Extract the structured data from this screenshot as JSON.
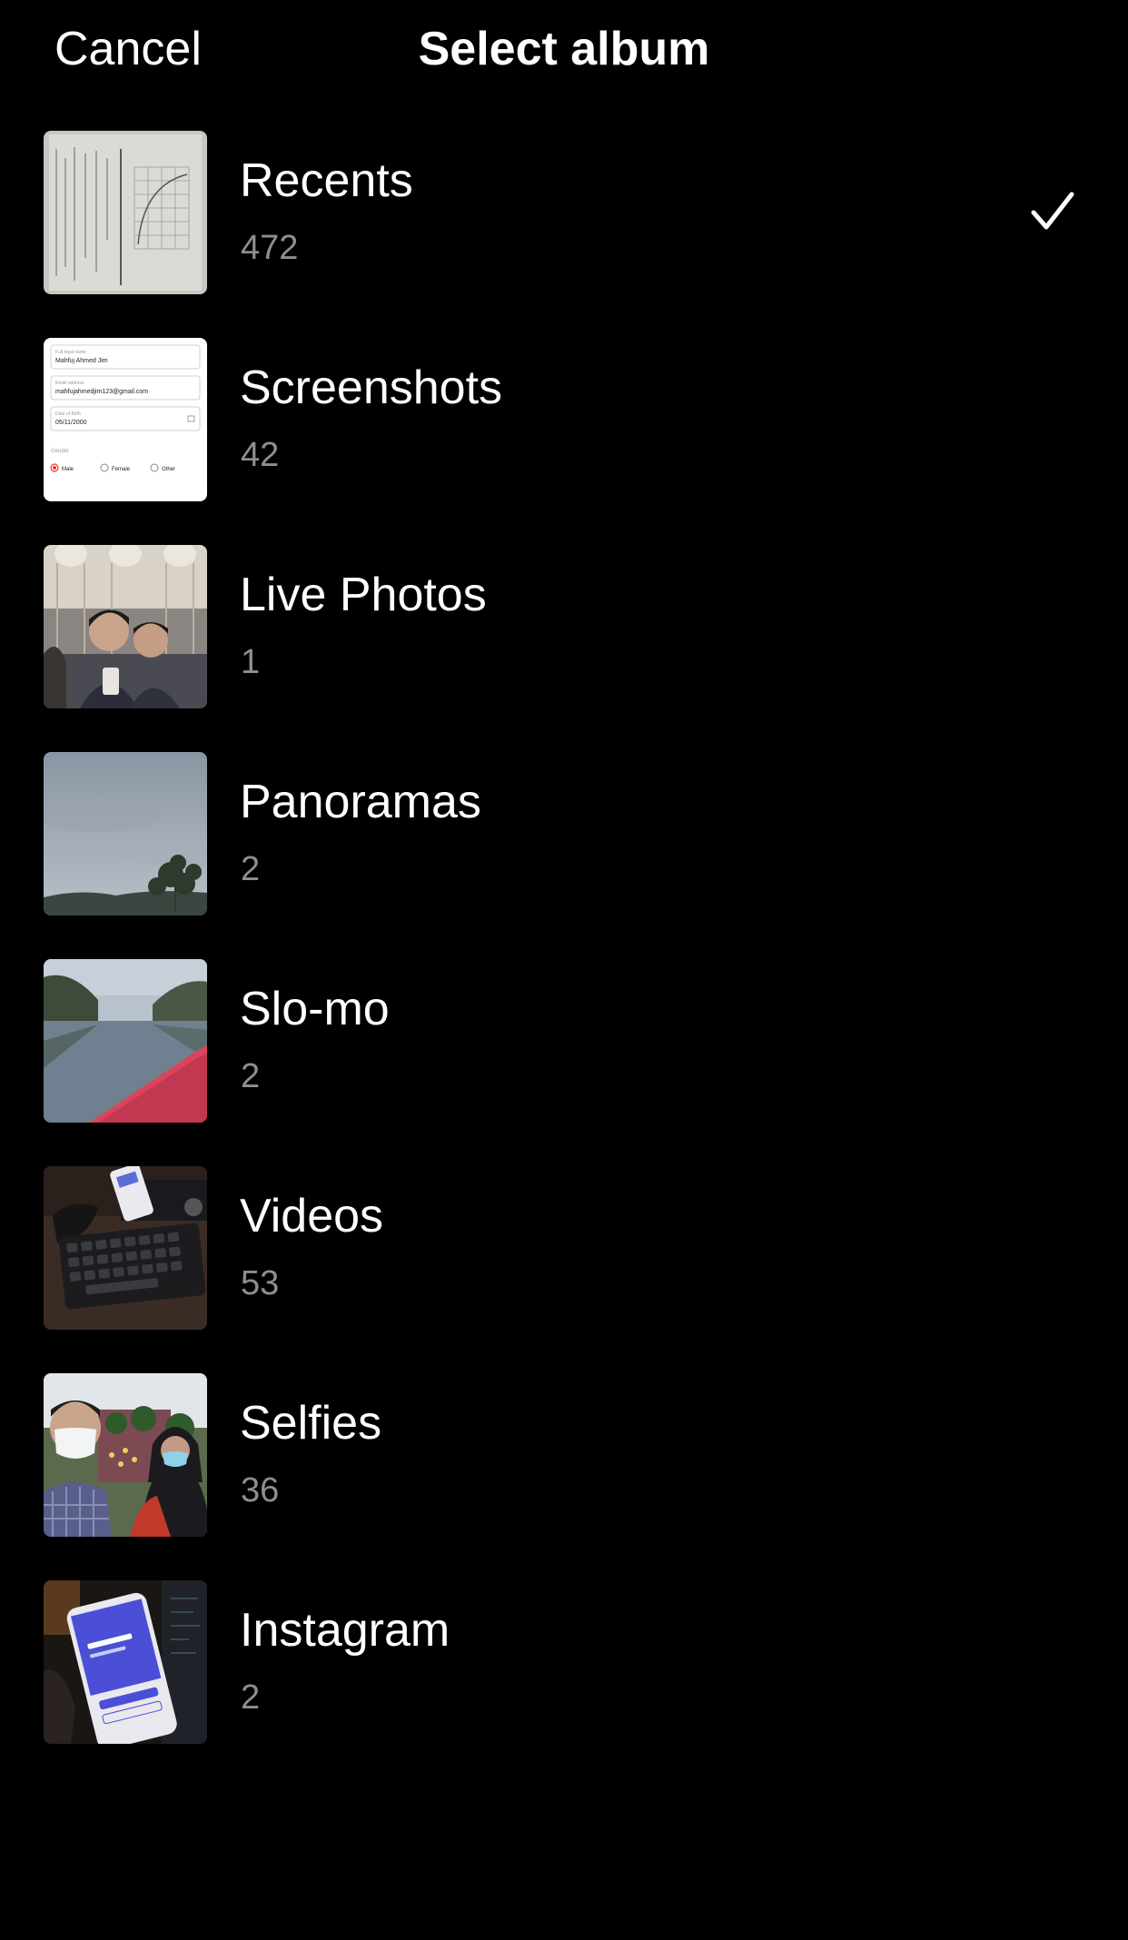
{
  "header": {
    "cancel_label": "Cancel",
    "title": "Select album"
  },
  "albums": [
    {
      "name": "Recents",
      "count": "472",
      "thumbnail": "notebook-page-with-graph",
      "selected": true
    },
    {
      "name": "Screenshots",
      "count": "42",
      "thumbnail": "form-screenshot",
      "selected": false
    },
    {
      "name": "Live Photos",
      "count": "1",
      "thumbnail": "two-people-selfie",
      "selected": false
    },
    {
      "name": "Panoramas",
      "count": "2",
      "thumbnail": "cloudy-sky-with-trees",
      "selected": false
    },
    {
      "name": "Slo-mo",
      "count": "2",
      "thumbnail": "river-with-boat",
      "selected": false
    },
    {
      "name": "Videos",
      "count": "53",
      "thumbnail": "keyboard-and-phone",
      "selected": false
    },
    {
      "name": "Selfies",
      "count": "36",
      "thumbnail": "two-people-masks",
      "selected": false
    },
    {
      "name": "Instagram",
      "count": "2",
      "thumbnail": "phone-app-screen",
      "selected": false
    }
  ],
  "form_thumb": {
    "name_label": "Full legal name",
    "name_value": "Mahfuj Ahmed Jim",
    "email_label": "Email address",
    "email_value": "mahfujahmedjim123@gmail.com",
    "dob_label": "Date of Birth",
    "dob_value": "05/11/2000",
    "gender_label": "Gender",
    "options": [
      "Male",
      "Female",
      "Other"
    ]
  },
  "colors": {
    "background": "#000000",
    "text": "#ffffff",
    "secondary_text": "#8e8e93"
  },
  "icons": {
    "selected": "checkmark-icon"
  }
}
